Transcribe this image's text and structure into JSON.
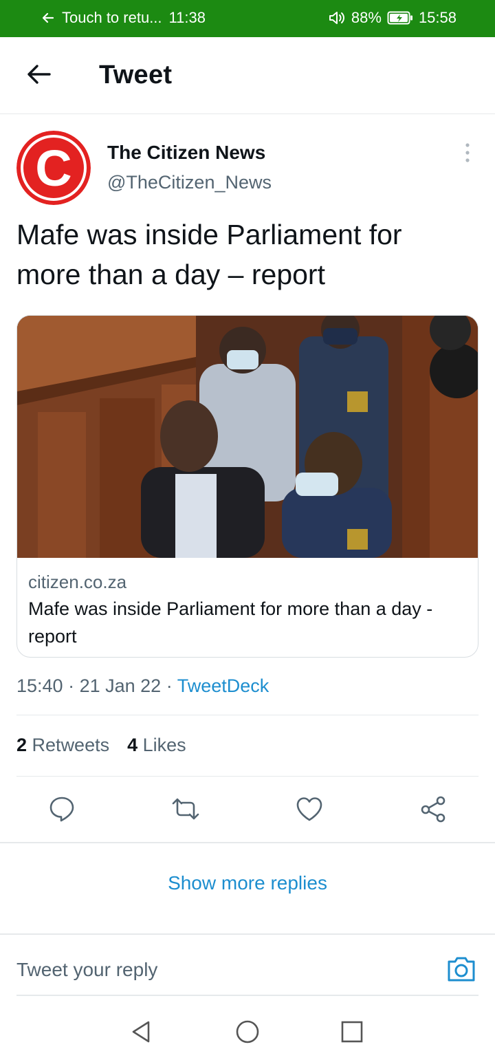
{
  "status_bar": {
    "return_text": "Touch to retu...",
    "call_time": "11:38",
    "battery_percent": "88%",
    "clock": "15:58",
    "background_color": "#1c8a12"
  },
  "header": {
    "title": "Tweet"
  },
  "tweet": {
    "author_name": "The Citizen News",
    "author_handle": "@TheCitizen_News",
    "avatar_letter": "C",
    "text": "Mafe was inside Parliament for more than a day – report",
    "card": {
      "domain": "citizen.co.za",
      "title": "Mafe was inside Parliament for more than a day - report"
    },
    "time": "15:40",
    "date": "21 Jan 22",
    "source": "TweetDeck",
    "retweets": {
      "count": "2",
      "label": "Retweets"
    },
    "likes": {
      "count": "4",
      "label": "Likes"
    }
  },
  "show_more_replies": "Show more replies",
  "reply": {
    "placeholder": "Tweet your reply"
  },
  "colors": {
    "link": "#1d8ecf",
    "secondary_text": "#536471",
    "avatar_red": "#e32221"
  },
  "icons": {
    "actions": [
      "reply-icon",
      "retweet-icon",
      "like-icon",
      "share-icon"
    ],
    "nav": [
      "back-triangle-icon",
      "home-circle-icon",
      "recents-square-icon"
    ]
  }
}
